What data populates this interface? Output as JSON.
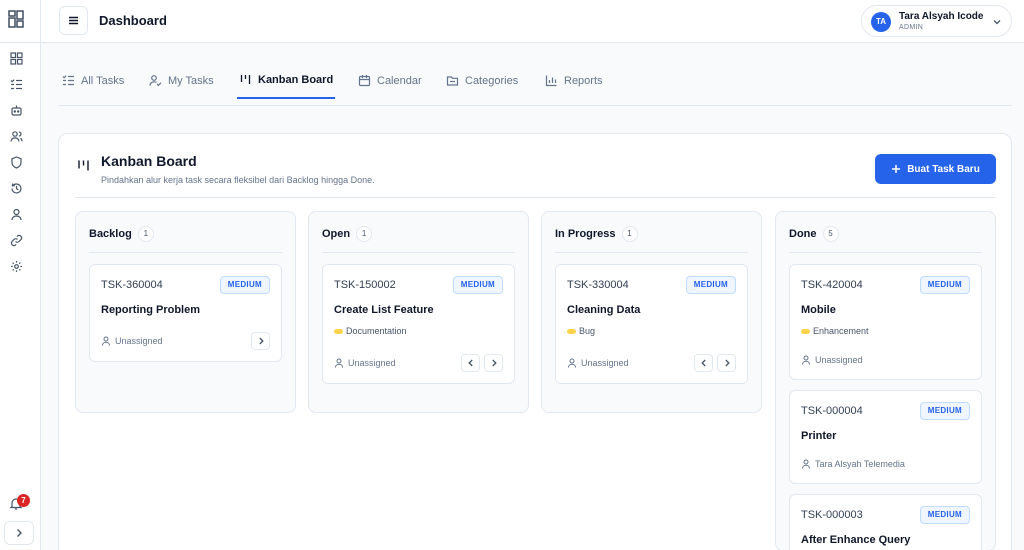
{
  "header": {
    "title": "Dashboard",
    "user": {
      "initials": "TA",
      "name": "Tara Alsyah Icode",
      "role": "ADMIN"
    }
  },
  "sidebar": {
    "items": [
      "dashboard-icon",
      "checklist-icon",
      "robot-icon",
      "users-icon",
      "shield-icon",
      "history-icon",
      "user-icon",
      "link-icon",
      "gear-icon"
    ],
    "notification_count": "7"
  },
  "tabs": [
    {
      "label": "All Tasks",
      "icon": "list-check-icon"
    },
    {
      "label": "My Tasks",
      "icon": "user-check-icon"
    },
    {
      "label": "Kanban Board",
      "icon": "kanban-icon",
      "active": true
    },
    {
      "label": "Calendar",
      "icon": "calendar-icon"
    },
    {
      "label": "Categories",
      "icon": "folder-icon"
    },
    {
      "label": "Reports",
      "icon": "bar-chart-icon"
    }
  ],
  "board": {
    "title": "Kanban Board",
    "subtitle": "Pindahkan alur kerja task secara fleksibel dari Backlog hingga Done.",
    "new_task_label": "Buat Task Baru",
    "accent": "#2563eb",
    "columns": [
      {
        "title": "Backlog",
        "count": "1",
        "cards": [
          {
            "id": "TSK-360004",
            "priority": "MEDIUM",
            "title": "Reporting Problem",
            "tag": "",
            "assignee": "Unassigned"
          }
        ]
      },
      {
        "title": "Open",
        "count": "1",
        "cards": [
          {
            "id": "TSK-150002",
            "priority": "MEDIUM",
            "title": "Create List Feature",
            "tag": "Documentation",
            "assignee": "Unassigned"
          }
        ]
      },
      {
        "title": "In Progress",
        "count": "1",
        "cards": [
          {
            "id": "TSK-330004",
            "priority": "MEDIUM",
            "title": "Cleaning Data",
            "tag": "Bug",
            "assignee": "Unassigned"
          }
        ]
      },
      {
        "title": "Done",
        "count": "5",
        "cards": [
          {
            "id": "TSK-420004",
            "priority": "MEDIUM",
            "title": "Mobile",
            "tag": "Enhancement",
            "assignee": "Unassigned"
          },
          {
            "id": "TSK-000004",
            "priority": "MEDIUM",
            "title": "Printer",
            "tag": "",
            "assignee": "Tara Alsyah Telemedia"
          },
          {
            "id": "TSK-000003",
            "priority": "MEDIUM",
            "title": "After Enhance Query",
            "tag": "",
            "assignee": ""
          }
        ]
      }
    ]
  }
}
